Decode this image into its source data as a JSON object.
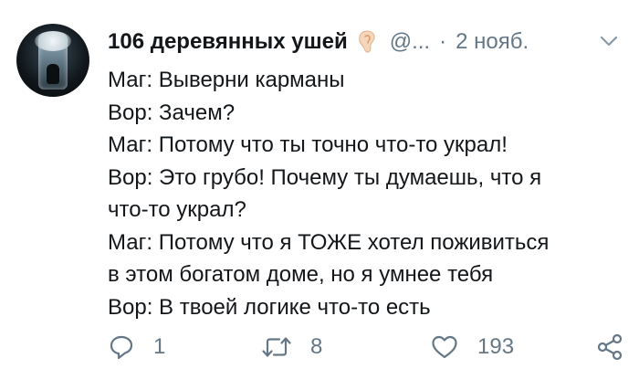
{
  "tweet": {
    "author_name": "106 деревянных ушей",
    "handle": "@...",
    "separator": "·",
    "date": "2 нояб.",
    "lines": [
      "Маг: Выверни карманы",
      "Вор: Зачем?",
      "Маг: Потому что ты точно что-то украл!",
      "Вор: Это грубо! Почему ты думаешь, что я",
      "что-то украл?",
      "Маг: Потому что я ТОЖЕ хотел поживиться",
      "в этом богатом доме, но я умнее тебя",
      "Вор: В твоей логике что-то есть"
    ],
    "actions": {
      "reply_count": "1",
      "retweet_count": "8",
      "like_count": "193"
    }
  },
  "icons": {
    "author_badge": "ear-icon",
    "menu": "chevron-down-icon",
    "reply": "reply-icon",
    "retweet": "retweet-icon",
    "like": "heart-icon",
    "share": "share-icon"
  },
  "colors": {
    "text_primary": "#14171a",
    "text_secondary": "#657786",
    "background": "#ffffff"
  }
}
